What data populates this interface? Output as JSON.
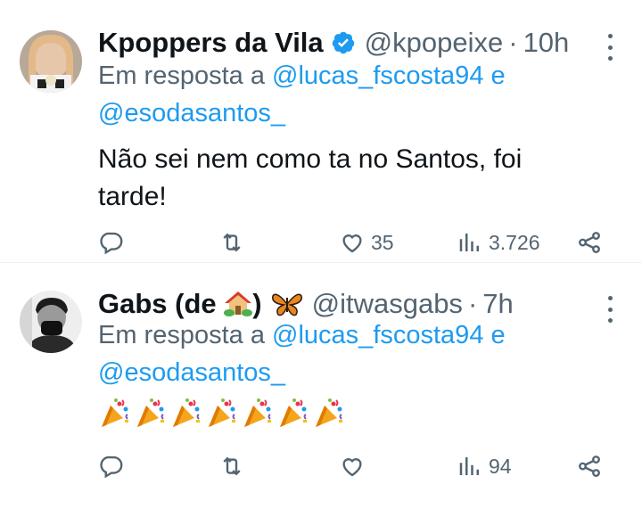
{
  "tweets": [
    {
      "name": "Kpoppers da Vila",
      "handle": "@kpopeixe",
      "sep": "·",
      "time": "10h",
      "reply_prefix": "Em resposta a",
      "mention1": "@lucas_fscosta94",
      "conj": "e",
      "mention2": "@esodasantos_",
      "text": "Não sei nem como ta no Santos, foi tarde!",
      "reply_count": "",
      "retweet_count": "",
      "like_count": "35",
      "view_count": "3.726",
      "verified": true
    },
    {
      "name": "Gabs (de 🏡) 🦋",
      "name_text": "Gabs (de",
      "name_close": ")",
      "handle": "@itwasgabs",
      "sep": "·",
      "time": "7h",
      "reply_prefix": "Em resposta a",
      "mention1": "@lucas_fscosta94",
      "conj": "e",
      "mention2": "@esodasantos_",
      "text": "🎉🎉🎉🎉🎉🎉🎉",
      "reply_count": "",
      "retweet_count": "",
      "like_count": "",
      "view_count": "94",
      "verified": false
    }
  ],
  "icons": [
    "reply-icon",
    "retweet-icon",
    "like-icon",
    "views-icon",
    "share-icon",
    "more-icon",
    "verified-badge-icon",
    "house-emoji-icon",
    "butterfly-emoji-icon",
    "party-popper-emoji-icon"
  ],
  "colors": {
    "accent": "#1d9bf0",
    "secondary_text": "#536471",
    "primary_text": "#0f1419"
  }
}
